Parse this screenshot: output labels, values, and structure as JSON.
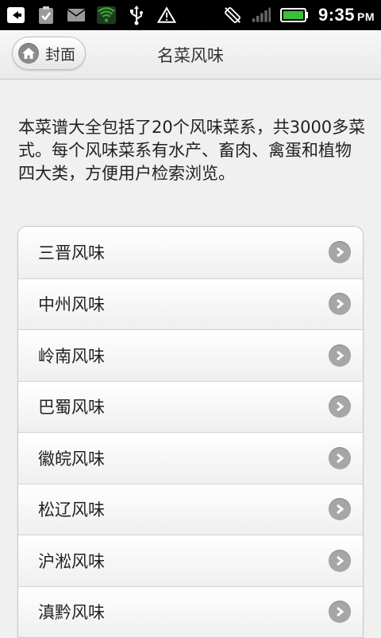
{
  "status_bar": {
    "time": "9:35",
    "ampm": "PM",
    "left_icons": [
      "back-arrow-icon",
      "clipboard-check-icon",
      "mail-icon",
      "wifi-icon",
      "usb-icon",
      "warning-icon"
    ],
    "right_icons": [
      "rotate-off-icon",
      "signal-icon",
      "battery-icon"
    ],
    "wifi_color": "#3aa83a",
    "battery_color": "#39c039"
  },
  "header": {
    "back_label": "封面",
    "title": "名菜风味"
  },
  "intro": "本菜谱大全包括了20个风味菜系，共3000多菜式。每个风味菜系有水产、畜肉、禽蛋和植物四大类，方便用户检索浏览。",
  "categories": [
    {
      "label": "三晋风味"
    },
    {
      "label": "中州风味"
    },
    {
      "label": "岭南风味"
    },
    {
      "label": "巴蜀风味"
    },
    {
      "label": "徽皖风味"
    },
    {
      "label": "松辽风味"
    },
    {
      "label": "沪淞风味"
    },
    {
      "label": "滇黔风味"
    }
  ]
}
